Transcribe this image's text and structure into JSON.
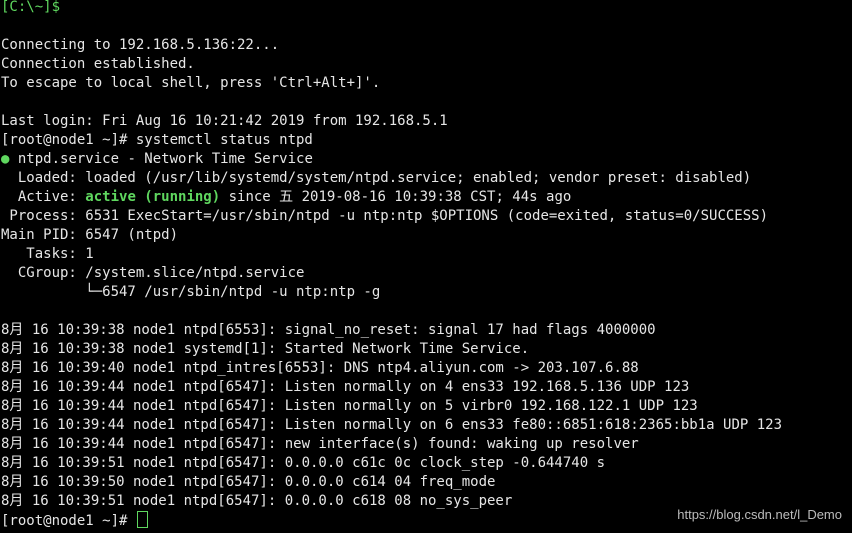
{
  "prompt_local": "[C:\\~]$",
  "connect": [
    "Connecting to 192.168.5.136:22...",
    "Connection established.",
    "To escape to local shell, press 'Ctrl+Alt+]'."
  ],
  "last_login": "Last login: Fri Aug 16 10:21:42 2019 from 192.168.5.1",
  "command_line": "[root@node1 ~]# systemctl status ntpd",
  "status": {
    "dot": "●",
    "title": " ntpd.service - Network Time Service",
    "loaded": "  Loaded: loaded (/usr/lib/systemd/system/ntpd.service; enabled; vendor preset: disabled)",
    "active_label": "  Active: ",
    "active_state": "active (running)",
    "active_rest": " since 五 2019-08-16 10:39:38 CST; 44s ago",
    "process": " Process: 6531 ExecStart=/usr/sbin/ntpd -u ntp:ntp $OPTIONS (code=exited, status=0/SUCCESS)",
    "main_pid": "Main PID: 6547 (ntpd)",
    "tasks": "   Tasks: 1",
    "cgroup": "  CGroup: /system.slice/ntpd.service",
    "cgroup_child": "          └─6547 /usr/sbin/ntpd -u ntp:ntp -g"
  },
  "logs": [
    "8月 16 10:39:38 node1 ntpd[6553]: signal_no_reset: signal 17 had flags 4000000",
    "8月 16 10:39:38 node1 systemd[1]: Started Network Time Service.",
    "8月 16 10:39:40 node1 ntpd_intres[6553]: DNS ntp4.aliyun.com -> 203.107.6.88",
    "8月 16 10:39:44 node1 ntpd[6547]: Listen normally on 4 ens33 192.168.5.136 UDP 123",
    "8月 16 10:39:44 node1 ntpd[6547]: Listen normally on 5 virbr0 192.168.122.1 UDP 123",
    "8月 16 10:39:44 node1 ntpd[6547]: Listen normally on 6 ens33 fe80::6851:618:2365:bb1a UDP 123",
    "8月 16 10:39:44 node1 ntpd[6547]: new interface(s) found: waking up resolver",
    "8月 16 10:39:51 node1 ntpd[6547]: 0.0.0.0 c61c 0c clock_step -0.644740 s",
    "8月 16 10:39:50 node1 ntpd[6547]: 0.0.0.0 c614 04 freq_mode",
    "8月 16 10:39:51 node1 ntpd[6547]: 0.0.0.0 c618 08 no_sys_peer"
  ],
  "final_prompt": "[root@node1 ~]# ",
  "watermark": "https://blog.csdn.net/l_Demo",
  "colors": {
    "background": "#000000",
    "text": "#e6e6e6",
    "accent_green": "#5fd75f"
  }
}
